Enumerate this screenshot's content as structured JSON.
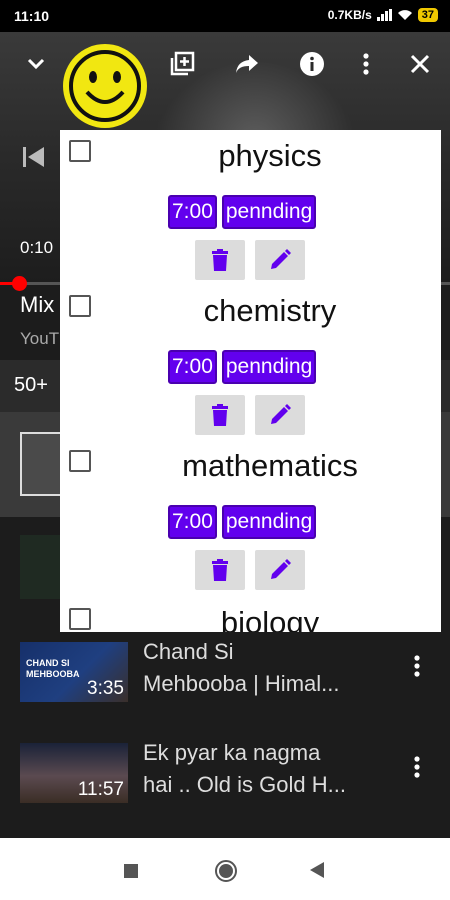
{
  "status_bar": {
    "time": "11:10",
    "speed": "0.7KB/s",
    "battery": "37"
  },
  "player": {
    "elapsed": "0:10"
  },
  "mix": {
    "title": "Mix",
    "subtitle": "YouT"
  },
  "queue": {
    "count": "50+"
  },
  "tasks": [
    {
      "name": "physics",
      "time": "7:00",
      "status": "pennding"
    },
    {
      "name": "chemistry",
      "time": "7:00",
      "status": "pennding"
    },
    {
      "name": "mathematics",
      "time": "7:00",
      "status": "pennding"
    },
    {
      "name": "biology"
    }
  ],
  "videos": [
    {
      "title": "Chand Si\nMehbooba | Himal...",
      "duration": "3:35",
      "thumb_text": "CHAND SI\nMEHBOOBA"
    },
    {
      "title": "Ek pyar ka nagma\nhai .. Old is Gold H...",
      "duration": "11:57"
    }
  ],
  "colors": {
    "accent": "#6200ee",
    "smiley": "#f1e711",
    "progress": "#ff0000"
  },
  "icons": [
    "chevron-down-icon",
    "add-to-playlist-icon",
    "share-icon",
    "info-icon",
    "more-vert-icon",
    "close-icon",
    "delete-icon",
    "edit-icon",
    "skip-previous-icon",
    "stop-icon",
    "home-icon",
    "back-icon"
  ]
}
